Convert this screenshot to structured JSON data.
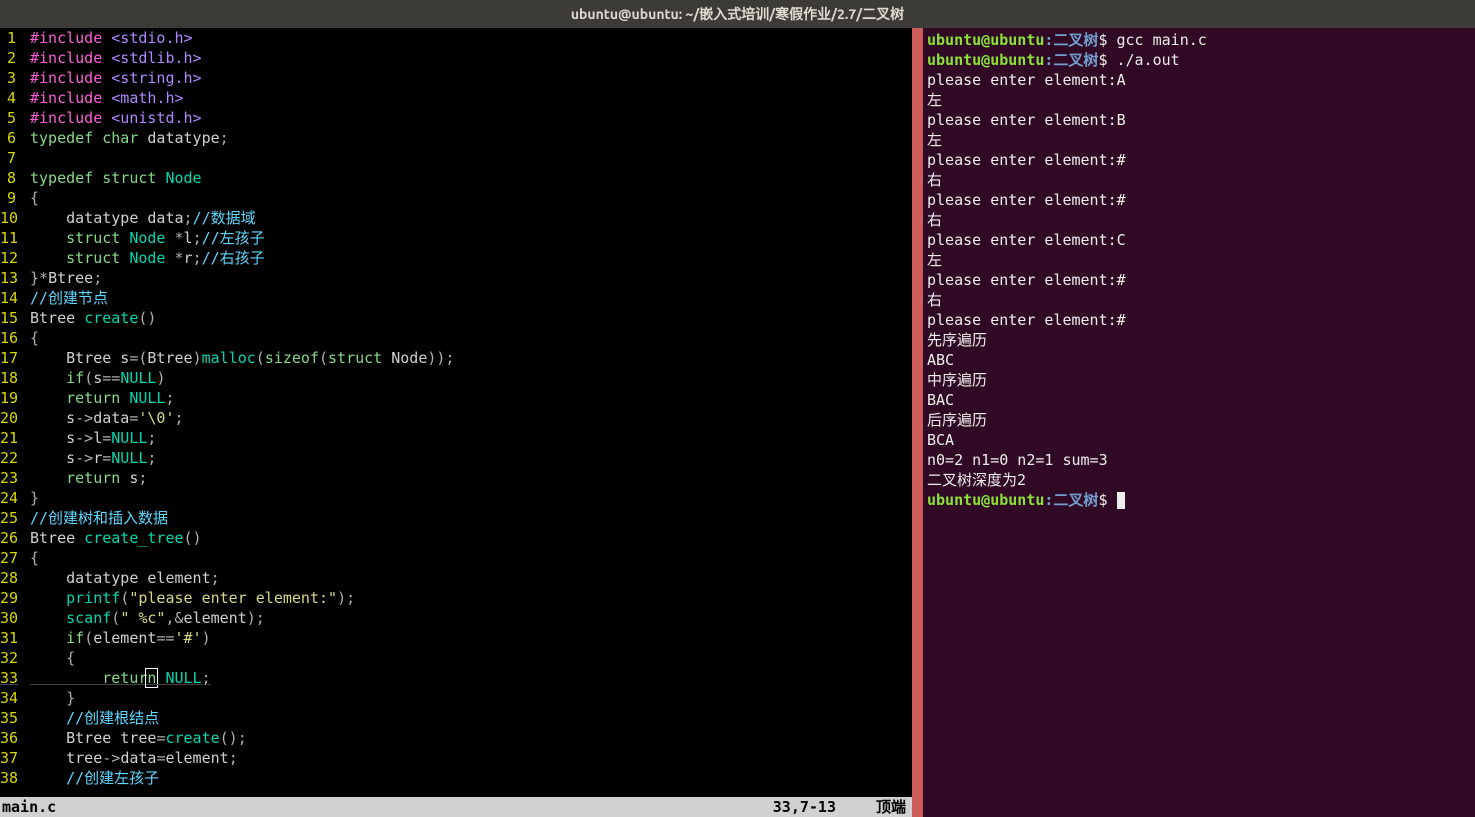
{
  "title_bar": "ubuntu@ubuntu: ~/嵌入式培训/寒假作业/2.7/二叉树",
  "status": {
    "file": "main.c",
    "position": "33,7-13",
    "scroll": "顶端"
  },
  "code": [
    {
      "n": 1,
      "seg": [
        [
          "pp",
          "#include "
        ],
        [
          "inc",
          "<stdio.h>"
        ]
      ]
    },
    {
      "n": 2,
      "seg": [
        [
          "pp",
          "#include "
        ],
        [
          "inc",
          "<stdlib.h>"
        ]
      ]
    },
    {
      "n": 3,
      "seg": [
        [
          "pp",
          "#include "
        ],
        [
          "inc",
          "<string.h>"
        ]
      ]
    },
    {
      "n": 4,
      "seg": [
        [
          "pp",
          "#include "
        ],
        [
          "inc",
          "<math.h>"
        ]
      ]
    },
    {
      "n": 5,
      "seg": [
        [
          "pp",
          "#include "
        ],
        [
          "inc",
          "<unistd.h>"
        ]
      ]
    },
    {
      "n": 6,
      "seg": [
        [
          "kw",
          "typedef"
        ],
        [
          "plain",
          " "
        ],
        [
          "type",
          "char"
        ],
        [
          "plain",
          " datatype"
        ],
        [
          "op",
          ";"
        ]
      ]
    },
    {
      "n": 7,
      "seg": [
        [
          "plain",
          ""
        ]
      ]
    },
    {
      "n": 8,
      "seg": [
        [
          "kw",
          "typedef"
        ],
        [
          "plain",
          " "
        ],
        [
          "type",
          "struct"
        ],
        [
          "plain",
          " "
        ],
        [
          "id",
          "Node"
        ]
      ]
    },
    {
      "n": 9,
      "seg": [
        [
          "op",
          "{"
        ]
      ]
    },
    {
      "n": 10,
      "seg": [
        [
          "plain",
          "    datatype data"
        ],
        [
          "op",
          ";"
        ],
        [
          "cmt",
          "//数据域"
        ]
      ]
    },
    {
      "n": 11,
      "seg": [
        [
          "plain",
          "    "
        ],
        [
          "type",
          "struct"
        ],
        [
          "plain",
          " "
        ],
        [
          "id",
          "Node"
        ],
        [
          "plain",
          " "
        ],
        [
          "op",
          "*"
        ],
        [
          "plain",
          "l"
        ],
        [
          "op",
          ";"
        ],
        [
          "cmt",
          "//左孩子"
        ]
      ]
    },
    {
      "n": 12,
      "seg": [
        [
          "plain",
          "    "
        ],
        [
          "type",
          "struct"
        ],
        [
          "plain",
          " "
        ],
        [
          "id",
          "Node"
        ],
        [
          "plain",
          " "
        ],
        [
          "op",
          "*"
        ],
        [
          "plain",
          "r"
        ],
        [
          "op",
          ";"
        ],
        [
          "cmt",
          "//右孩子"
        ]
      ]
    },
    {
      "n": 13,
      "seg": [
        [
          "op",
          "}*"
        ],
        [
          "plain",
          "Btree"
        ],
        [
          "op",
          ";"
        ]
      ]
    },
    {
      "n": 14,
      "seg": [
        [
          "cmt",
          "//创建节点"
        ]
      ]
    },
    {
      "n": 15,
      "seg": [
        [
          "plain",
          "Btree "
        ],
        [
          "id",
          "create"
        ],
        [
          "op",
          "()"
        ]
      ]
    },
    {
      "n": 16,
      "seg": [
        [
          "op",
          "{"
        ]
      ]
    },
    {
      "n": 17,
      "seg": [
        [
          "plain",
          "    Btree s"
        ],
        [
          "op",
          "=("
        ],
        [
          "plain",
          "Btree"
        ],
        [
          "op",
          ")"
        ],
        [
          "id",
          "malloc"
        ],
        [
          "op",
          "("
        ],
        [
          "kw",
          "sizeof"
        ],
        [
          "op",
          "("
        ],
        [
          "type",
          "struct"
        ],
        [
          "plain",
          " Node"
        ],
        [
          "op",
          "));"
        ]
      ]
    },
    {
      "n": 18,
      "seg": [
        [
          "plain",
          "    "
        ],
        [
          "kw",
          "if"
        ],
        [
          "op",
          "("
        ],
        [
          "plain",
          "s"
        ],
        [
          "op",
          "=="
        ],
        [
          "id",
          "NULL"
        ],
        [
          "op",
          ")"
        ]
      ]
    },
    {
      "n": 19,
      "seg": [
        [
          "plain",
          "    "
        ],
        [
          "kw",
          "return"
        ],
        [
          "plain",
          " "
        ],
        [
          "id",
          "NULL"
        ],
        [
          "op",
          ";"
        ]
      ]
    },
    {
      "n": 20,
      "seg": [
        [
          "plain",
          "    s"
        ],
        [
          "op",
          "->"
        ],
        [
          "plain",
          "data"
        ],
        [
          "op",
          "="
        ],
        [
          "str",
          "'\\0'"
        ],
        [
          "op",
          ";"
        ]
      ]
    },
    {
      "n": 21,
      "seg": [
        [
          "plain",
          "    s"
        ],
        [
          "op",
          "->"
        ],
        [
          "plain",
          "l"
        ],
        [
          "op",
          "="
        ],
        [
          "id",
          "NULL"
        ],
        [
          "op",
          ";"
        ]
      ]
    },
    {
      "n": 22,
      "seg": [
        [
          "plain",
          "    s"
        ],
        [
          "op",
          "->"
        ],
        [
          "plain",
          "r"
        ],
        [
          "op",
          "="
        ],
        [
          "id",
          "NULL"
        ],
        [
          "op",
          ";"
        ]
      ]
    },
    {
      "n": 23,
      "seg": [
        [
          "plain",
          "    "
        ],
        [
          "kw",
          "return"
        ],
        [
          "plain",
          " s"
        ],
        [
          "op",
          ";"
        ]
      ]
    },
    {
      "n": 24,
      "seg": [
        [
          "op",
          "}"
        ]
      ]
    },
    {
      "n": 25,
      "seg": [
        [
          "cmt",
          "//创建树和插入数据"
        ]
      ]
    },
    {
      "n": 26,
      "seg": [
        [
          "plain",
          "Btree "
        ],
        [
          "id",
          "create_tree"
        ],
        [
          "op",
          "()"
        ]
      ]
    },
    {
      "n": 27,
      "seg": [
        [
          "op",
          "{"
        ]
      ]
    },
    {
      "n": 28,
      "seg": [
        [
          "plain",
          "    datatype element"
        ],
        [
          "op",
          ";"
        ]
      ]
    },
    {
      "n": 29,
      "seg": [
        [
          "plain",
          "    "
        ],
        [
          "id",
          "printf"
        ],
        [
          "op",
          "("
        ],
        [
          "str",
          "\"please enter element:\""
        ],
        [
          "op",
          ");"
        ]
      ]
    },
    {
      "n": 30,
      "seg": [
        [
          "plain",
          "    "
        ],
        [
          "id",
          "scanf"
        ],
        [
          "op",
          "("
        ],
        [
          "str",
          "\" %c\""
        ],
        [
          "op",
          ",&"
        ],
        [
          "plain",
          "element"
        ],
        [
          "op",
          ");"
        ]
      ]
    },
    {
      "n": 31,
      "seg": [
        [
          "plain",
          "    "
        ],
        [
          "kw",
          "if"
        ],
        [
          "op",
          "("
        ],
        [
          "plain",
          "element"
        ],
        [
          "op",
          "=="
        ],
        [
          "str",
          "'#'"
        ],
        [
          "op",
          ")"
        ]
      ]
    },
    {
      "n": 32,
      "seg": [
        [
          "plain",
          "    "
        ],
        [
          "op",
          "{"
        ]
      ]
    },
    {
      "n": 33,
      "cursor": true,
      "seg": [
        [
          "plain",
          "        "
        ],
        [
          "kw",
          "retur"
        ],
        [
          "cursor",
          "n"
        ],
        [
          "plain",
          " "
        ],
        [
          "id",
          "NULL"
        ],
        [
          "op",
          ";"
        ]
      ]
    },
    {
      "n": 34,
      "seg": [
        [
          "plain",
          "    "
        ],
        [
          "op",
          "}"
        ]
      ]
    },
    {
      "n": 35,
      "seg": [
        [
          "plain",
          "    "
        ],
        [
          "cmt",
          "//创建根结点"
        ]
      ]
    },
    {
      "n": 36,
      "seg": [
        [
          "plain",
          "    Btree tree"
        ],
        [
          "op",
          "="
        ],
        [
          "id",
          "create"
        ],
        [
          "op",
          "();"
        ]
      ]
    },
    {
      "n": 37,
      "seg": [
        [
          "plain",
          "    tree"
        ],
        [
          "op",
          "->"
        ],
        [
          "plain",
          "data"
        ],
        [
          "op",
          "="
        ],
        [
          "plain",
          "element"
        ],
        [
          "op",
          ";"
        ]
      ]
    },
    {
      "n": 38,
      "seg": [
        [
          "plain",
          "    "
        ],
        [
          "cmt",
          "//创建左孩子"
        ]
      ]
    }
  ],
  "terminal": {
    "prompt_user": "ubuntu@ubuntu",
    "prompt_path": ":二叉树",
    "prompt_dollar": "$",
    "lines": [
      {
        "type": "prompt",
        "cmd": " gcc main.c"
      },
      {
        "type": "prompt",
        "cmd": " ./a.out"
      },
      {
        "type": "out",
        "text": "please enter element:A"
      },
      {
        "type": "out",
        "text": "左"
      },
      {
        "type": "out",
        "text": "please enter element:B"
      },
      {
        "type": "out",
        "text": "左"
      },
      {
        "type": "out",
        "text": "please enter element:#"
      },
      {
        "type": "out",
        "text": "右"
      },
      {
        "type": "out",
        "text": "please enter element:#"
      },
      {
        "type": "out",
        "text": "右"
      },
      {
        "type": "out",
        "text": "please enter element:C"
      },
      {
        "type": "out",
        "text": "左"
      },
      {
        "type": "out",
        "text": "please enter element:#"
      },
      {
        "type": "out",
        "text": "右"
      },
      {
        "type": "out",
        "text": "please enter element:#"
      },
      {
        "type": "out",
        "text": "先序遍历"
      },
      {
        "type": "out",
        "text": "ABC"
      },
      {
        "type": "out",
        "text": "中序遍历"
      },
      {
        "type": "out",
        "text": "BAC"
      },
      {
        "type": "out",
        "text": "后序遍历"
      },
      {
        "type": "out",
        "text": "BCA"
      },
      {
        "type": "out",
        "text": "n0=2 n1=0 n2=1 sum=3"
      },
      {
        "type": "out",
        "text": "二叉树深度为2"
      },
      {
        "type": "prompt",
        "cmd": " ",
        "cursor": true
      }
    ]
  }
}
